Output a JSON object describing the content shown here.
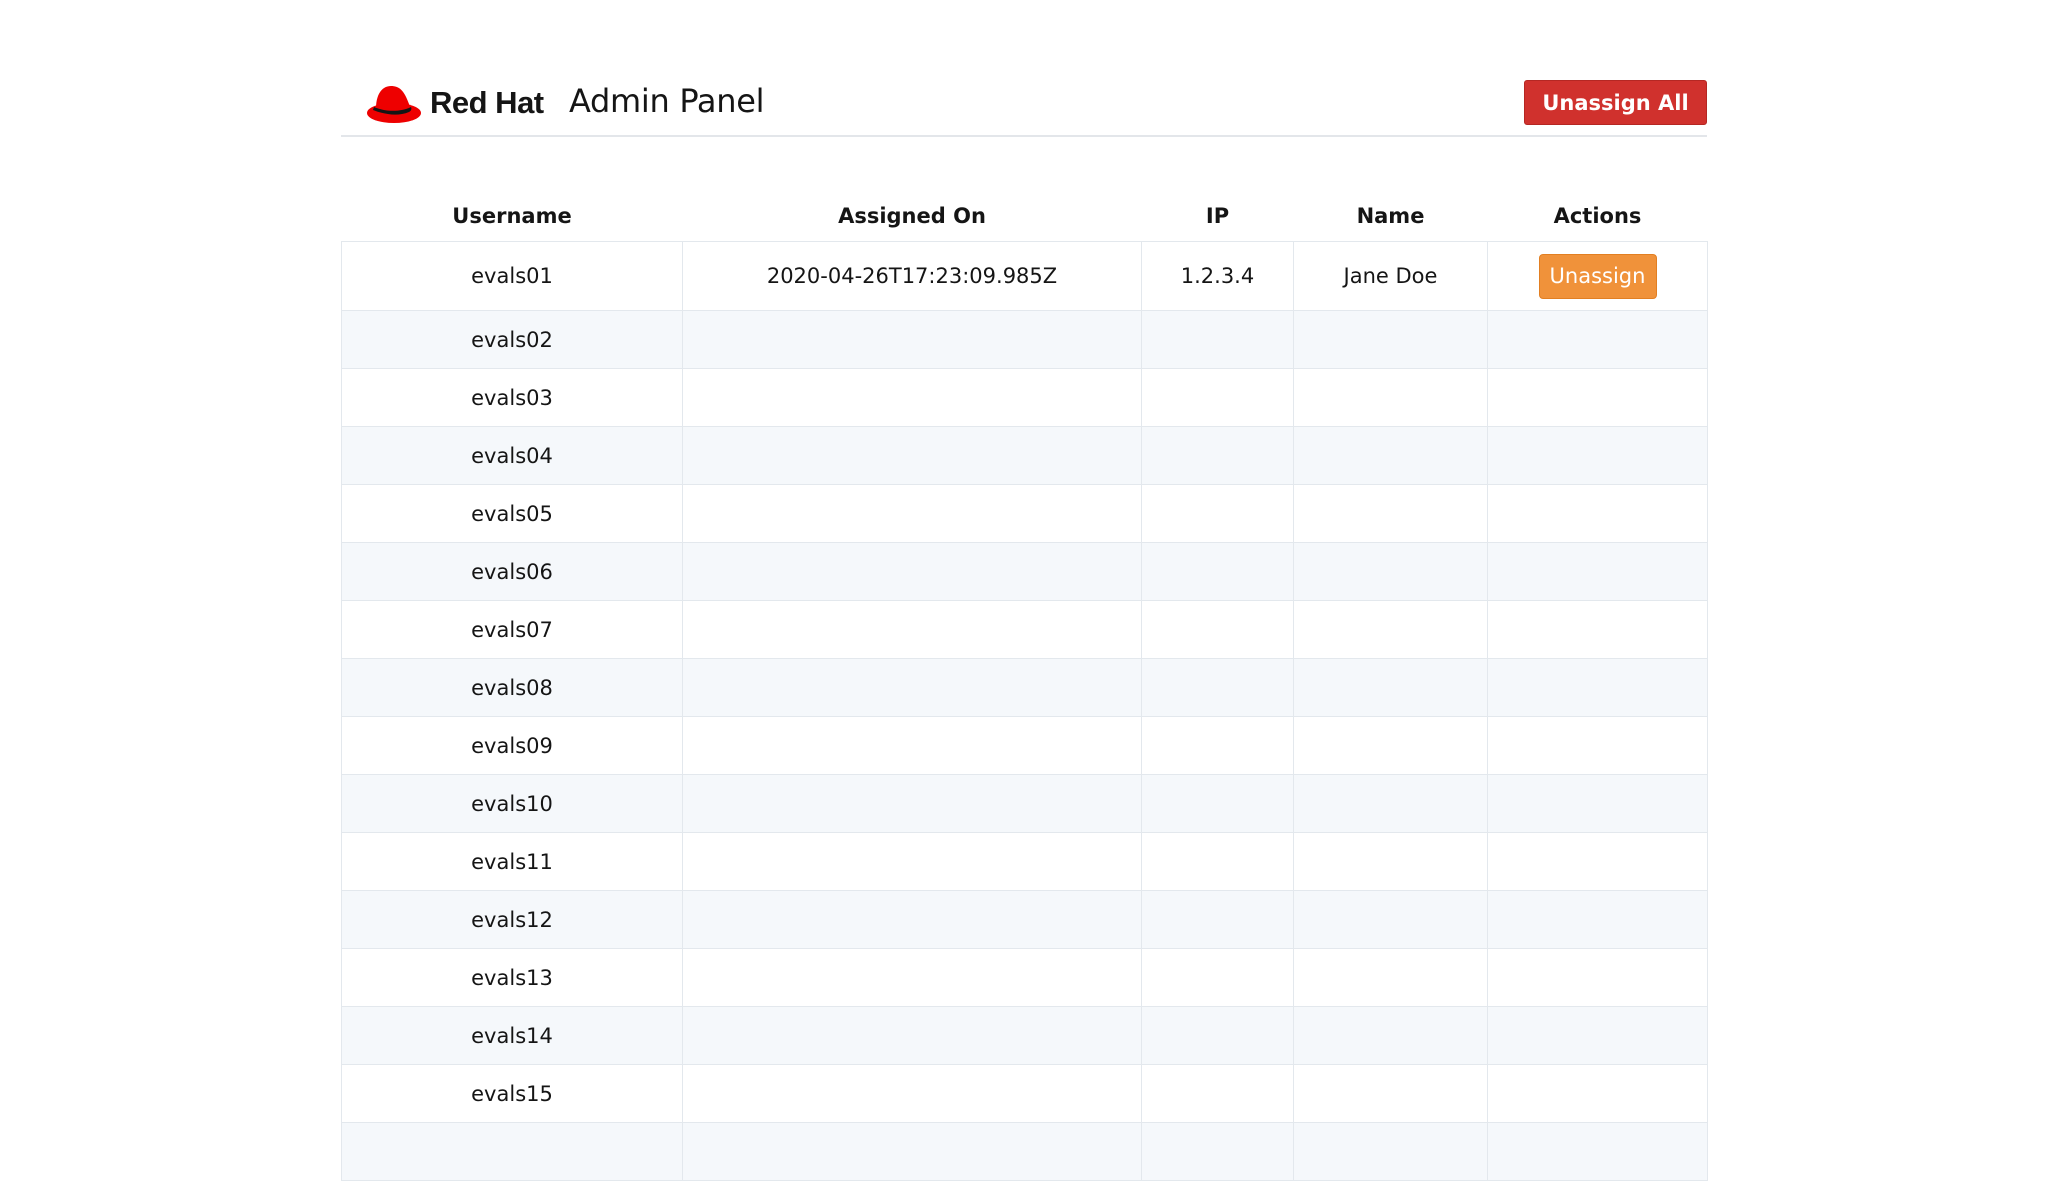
{
  "header": {
    "logo_text": "Red Hat",
    "title": "Admin Panel",
    "unassign_all_label": "Unassign All"
  },
  "colors": {
    "logo_red": "#ee0000",
    "danger_button": "#d0312d",
    "warning_button": "#f0923a",
    "row_stripe": "#f5f8fb"
  },
  "table": {
    "columns": [
      "Username",
      "Assigned On",
      "IP",
      "Name",
      "Actions"
    ],
    "rows": [
      {
        "username": "evals01",
        "assigned_on": "2020-04-26T17:23:09.985Z",
        "ip": "1.2.3.4",
        "name": "Jane Doe",
        "action": "Unassign"
      },
      {
        "username": "evals02",
        "assigned_on": "",
        "ip": "",
        "name": "",
        "action": ""
      },
      {
        "username": "evals03",
        "assigned_on": "",
        "ip": "",
        "name": "",
        "action": ""
      },
      {
        "username": "evals04",
        "assigned_on": "",
        "ip": "",
        "name": "",
        "action": ""
      },
      {
        "username": "evals05",
        "assigned_on": "",
        "ip": "",
        "name": "",
        "action": ""
      },
      {
        "username": "evals06",
        "assigned_on": "",
        "ip": "",
        "name": "",
        "action": ""
      },
      {
        "username": "evals07",
        "assigned_on": "",
        "ip": "",
        "name": "",
        "action": ""
      },
      {
        "username": "evals08",
        "assigned_on": "",
        "ip": "",
        "name": "",
        "action": ""
      },
      {
        "username": "evals09",
        "assigned_on": "",
        "ip": "",
        "name": "",
        "action": ""
      },
      {
        "username": "evals10",
        "assigned_on": "",
        "ip": "",
        "name": "",
        "action": ""
      },
      {
        "username": "evals11",
        "assigned_on": "",
        "ip": "",
        "name": "",
        "action": ""
      },
      {
        "username": "evals12",
        "assigned_on": "",
        "ip": "",
        "name": "",
        "action": ""
      },
      {
        "username": "evals13",
        "assigned_on": "",
        "ip": "",
        "name": "",
        "action": ""
      },
      {
        "username": "evals14",
        "assigned_on": "",
        "ip": "",
        "name": "",
        "action": ""
      },
      {
        "username": "evals15",
        "assigned_on": "",
        "ip": "",
        "name": "",
        "action": ""
      },
      {
        "username": "",
        "assigned_on": "",
        "ip": "",
        "name": "",
        "action": ""
      }
    ]
  }
}
